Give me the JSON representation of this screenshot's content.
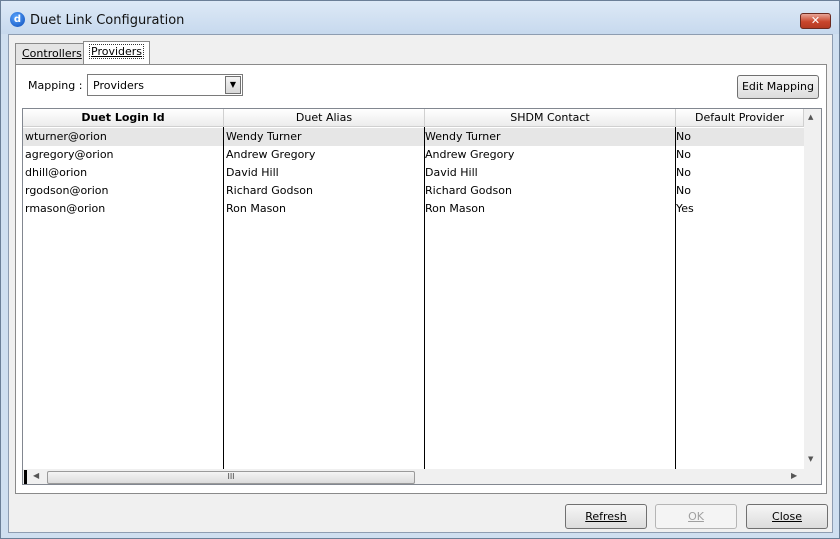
{
  "window": {
    "title": "Duet Link Configuration",
    "close_glyph": "✕",
    "icon": "duet-logo-icon"
  },
  "tabs": [
    {
      "label": "Controllers",
      "active": false
    },
    {
      "label": "Providers",
      "active": true
    }
  ],
  "mapping": {
    "label": "Mapping :",
    "value": "Providers",
    "dropdown_glyph": "▼"
  },
  "buttons": {
    "edit_mapping": "Edit Mapping",
    "refresh": "Refresh",
    "ok": "OK",
    "close": "Close"
  },
  "table": {
    "columns": [
      "Duet Login Id",
      "Duet Alias",
      "SHDM Contact",
      "Default Provider"
    ],
    "rows": [
      [
        "wturner@orion",
        "Wendy Turner",
        "Wendy Turner",
        "No"
      ],
      [
        "agregory@orion",
        "Andrew Gregory",
        "Andrew Gregory",
        "No"
      ],
      [
        "dhill@orion",
        "David Hill",
        "David Hill",
        "No"
      ],
      [
        "rgodson@orion",
        "Richard Godson",
        "Richard Godson",
        "No"
      ],
      [
        "rmason@orion",
        "Ron Mason",
        "Ron Mason",
        "Yes"
      ]
    ],
    "selected_row": 0
  },
  "scrollbars": {
    "up": "▲",
    "down": "▼",
    "left": "◀",
    "right": "▶",
    "grip": "III"
  }
}
